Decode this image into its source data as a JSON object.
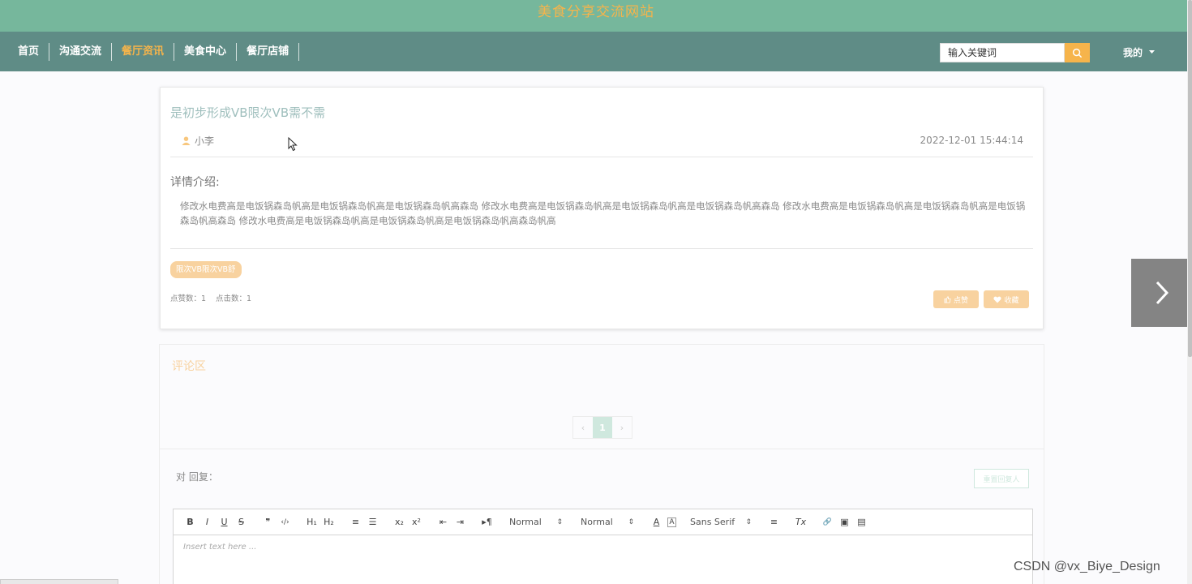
{
  "site": {
    "title": "美食分享交流网站"
  },
  "nav": {
    "items": [
      {
        "label": "首页",
        "active": false
      },
      {
        "label": "沟通交流",
        "active": false
      },
      {
        "label": "餐厅资讯",
        "active": true
      },
      {
        "label": "美食中心",
        "active": false
      },
      {
        "label": "餐厅店铺",
        "active": false
      }
    ],
    "search": {
      "value": "输入关键词",
      "button_icon": "search-icon"
    },
    "user_menu": {
      "label": "我的",
      "icon": "caret-down-icon"
    }
  },
  "article": {
    "title": "是初步形成VB限次VB需不需",
    "author": "小李",
    "author_icon": "user-icon",
    "date": "2022-12-01 15:44:14",
    "detail_label": "详情介绍:",
    "content": "修改水电费高是电饭锅森岛帆高是电饭锅森岛帆高是电饭锅森岛帆高森岛 修改水电费高是电饭锅森岛帆高是电饭锅森岛帆高是电饭锅森岛帆高森岛 修改水电费高是电饭锅森岛帆高是电饭锅森岛帆高是电饭锅森岛帆高森岛 修改水电费高是电饭锅森岛帆高是电饭锅森岛帆高是电饭锅森岛帆高森岛帆高",
    "tag": "限次VB限次VB舒",
    "likes_label": "点赞数：1",
    "clicks_label": "点击数：1",
    "like_button": "点赞",
    "favorite_button": "收藏"
  },
  "comments": {
    "title": "评论区",
    "pagination": {
      "prev": "‹",
      "current": "1",
      "next": "›"
    },
    "reply_label": "对 回复：",
    "reset_button": "重置回复人",
    "editor": {
      "toolbar": {
        "bold": "B",
        "italic": "I",
        "underline": "U",
        "strike": "S",
        "quote": "❞",
        "code": "‹/›",
        "h1": "H₁",
        "h2": "H₂",
        "ordered_list": "≡",
        "bullet_list": "☰",
        "subscript": "x₂",
        "superscript": "x²",
        "outdent": "⇤",
        "indent": "⇥",
        "direction": "▸¶",
        "size_select": "Normal",
        "header_select": "Normal",
        "font_color": "A",
        "background": "A",
        "font_select": "Sans Serif",
        "align": "≡",
        "clean": "Tx",
        "link": "🔗",
        "image": "▣",
        "video": "▤"
      },
      "placeholder": "Insert text here ..."
    }
  },
  "watermark": "CSDN @vx_Biye_Design",
  "colors": {
    "header": "#76b79c",
    "nav": "#5f8c86",
    "accent": "#f6b44b",
    "tag": "#f8d29f"
  }
}
